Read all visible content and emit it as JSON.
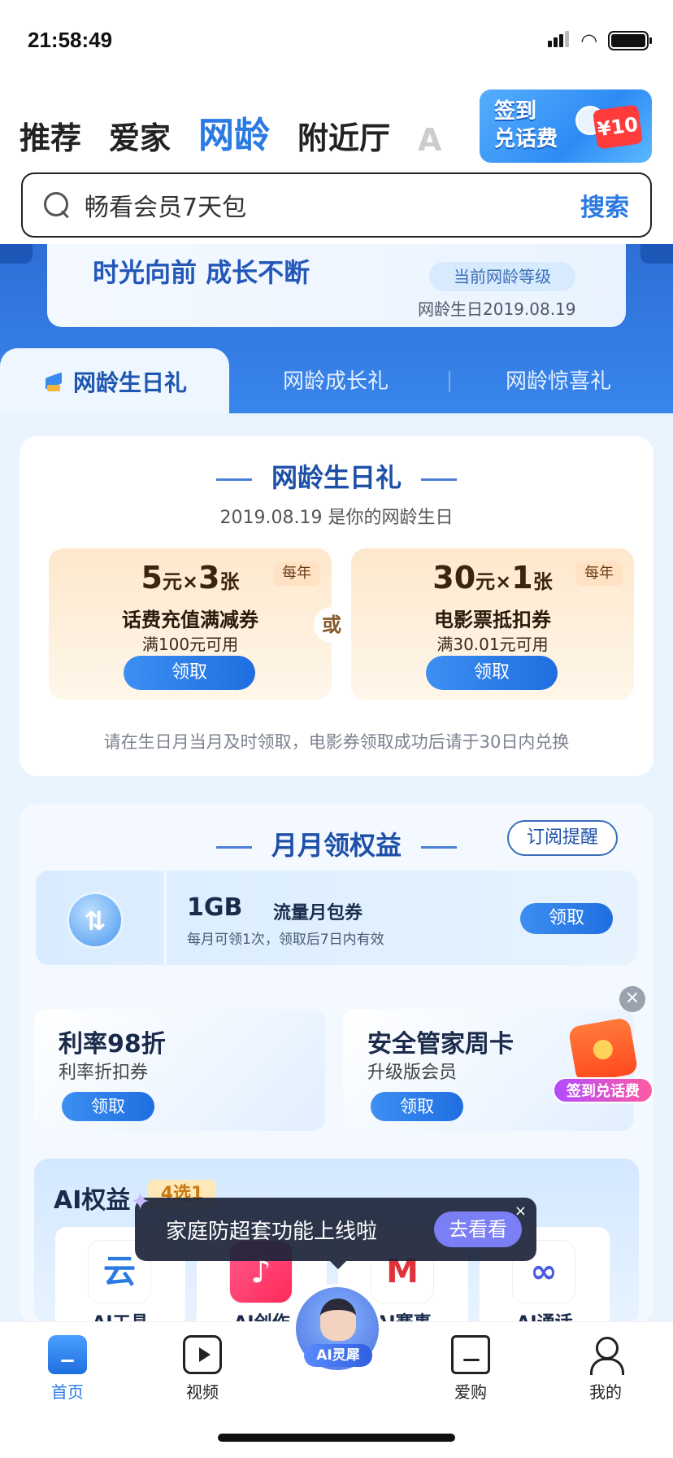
{
  "status": {
    "time": "21:58:49"
  },
  "top_tabs": [
    "推荐",
    "爱家",
    "网龄",
    "附近厅",
    "A"
  ],
  "sign_banner": {
    "line1": "签到",
    "line2": "兑话费",
    "badge": "¥10"
  },
  "search": {
    "placeholder": "畅看会员7天包",
    "button": "搜索"
  },
  "hero": {
    "slogan": "时光向前 成长不断",
    "level_label": "当前网龄等级",
    "birthday": "网龄生日2019.08.19"
  },
  "sub_tabs": [
    "网龄生日礼",
    "网龄成长礼",
    "网龄惊喜礼"
  ],
  "birthday_gift": {
    "title": "网龄生日礼",
    "subtitle": "2019.08.19 是你的网龄生日",
    "or_label": "或",
    "coupons": [
      {
        "amount": "5",
        "unit": "元",
        "times": "×",
        "count": "3",
        "count_unit": "张",
        "freq": "每年",
        "name": "话费充值满减券",
        "condition": "满100元可用",
        "button": "领取"
      },
      {
        "amount": "30",
        "unit": "元",
        "times": "×",
        "count": "1",
        "count_unit": "张",
        "freq": "每年",
        "name": "电影票抵扣券",
        "condition": "满30.01元可用",
        "button": "领取"
      }
    ],
    "note": "请在生日月当月及时领取，电影券领取成功后请于30日内兑换"
  },
  "monthly": {
    "title": "月月领权益",
    "subscribe": "订阅提醒",
    "flow": {
      "amount": "1GB",
      "label": "流量月包券",
      "desc": "每月可领1次，领取后7日内有效",
      "button": "领取"
    },
    "cards": [
      {
        "title": "利率98折",
        "subtitle": "利率折扣券",
        "button": "领取"
      },
      {
        "title": "安全管家周卡",
        "subtitle": "升级版会员",
        "button": "领取"
      }
    ],
    "ai": {
      "title": "AI权益",
      "tag": "4选1",
      "items": [
        {
          "name": "AI工具",
          "glyph": "云"
        },
        {
          "name": "AI创作",
          "glyph": "♪"
        },
        {
          "name": "AI赛事",
          "glyph": "M"
        },
        {
          "name": "AI通话",
          "glyph": "∞"
        }
      ]
    }
  },
  "toast": {
    "message": "家庭防超套功能上线啦",
    "button": "去看看",
    "close": "×"
  },
  "floating": {
    "label": "签到兑话费",
    "close": "×"
  },
  "bottom_nav": [
    {
      "label": "首页",
      "icon": "home-icon",
      "active": true
    },
    {
      "label": "视频",
      "icon": "video-icon"
    },
    {
      "label": "AI灵犀",
      "icon": "ai-assistant-icon"
    },
    {
      "label": "爱购",
      "icon": "shop-icon"
    },
    {
      "label": "我的",
      "icon": "profile-icon"
    }
  ],
  "colors": {
    "accent": "#2a7ae2",
    "hero_blue": "#3a8af0",
    "button_blue": "#1f6ee0"
  }
}
